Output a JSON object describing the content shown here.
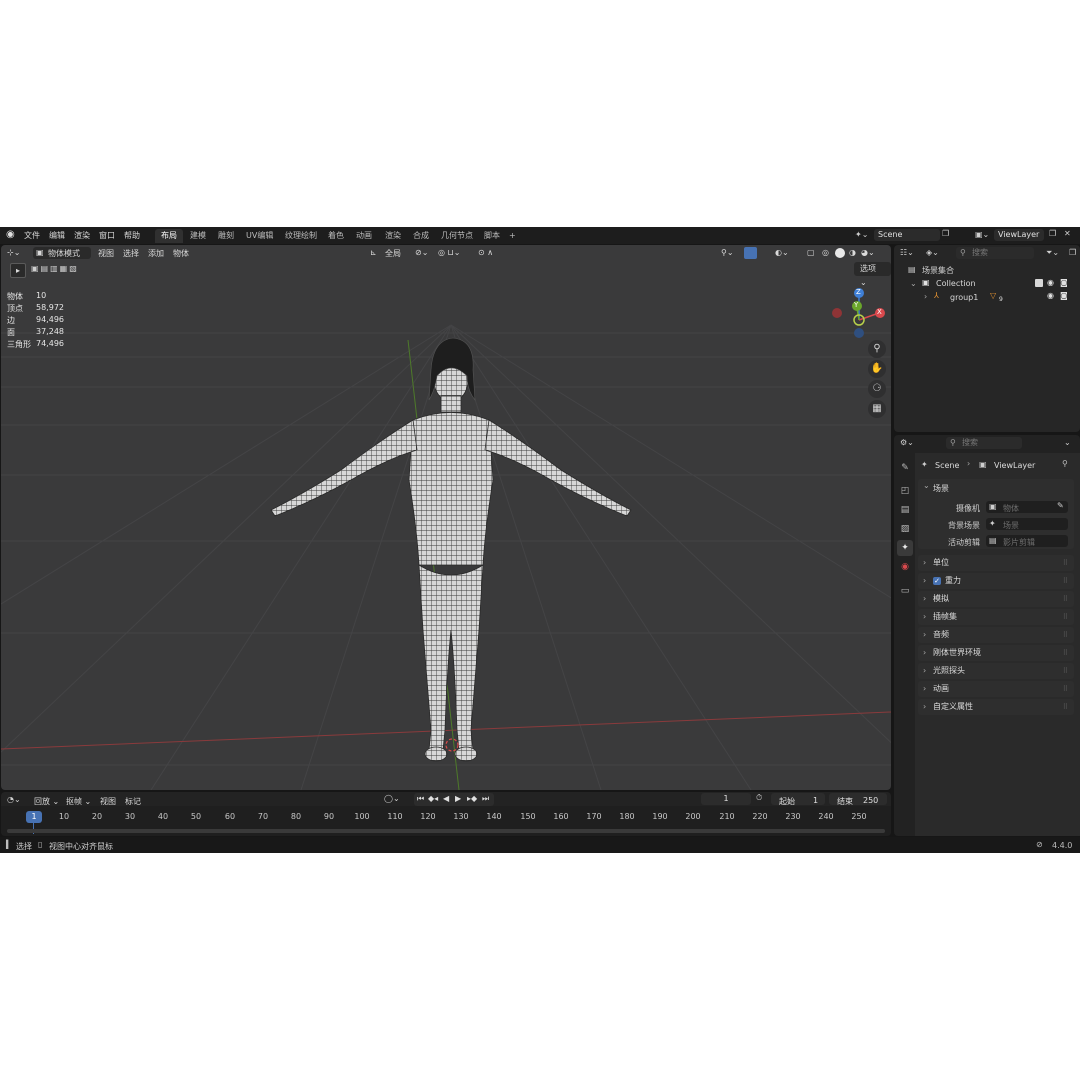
{
  "menu": {
    "items": [
      "文件",
      "编辑",
      "渲染",
      "窗口",
      "帮助"
    ]
  },
  "workspaces": {
    "tabs": [
      "布局",
      "建模",
      "雕刻",
      "UV编辑",
      "纹理绘制",
      "着色",
      "动画",
      "渲染",
      "合成",
      "几何节点",
      "脚本"
    ],
    "add": "+"
  },
  "scene": {
    "name": "Scene",
    "view_layer": "ViewLayer"
  },
  "viewport": {
    "mode": "物体模式",
    "menus": [
      "视图",
      "选择",
      "添加",
      "物体"
    ],
    "transform": "全局",
    "options": "选项",
    "stats": [
      {
        "label": "物体",
        "value": "10"
      },
      {
        "label": "顶点",
        "value": "58,972"
      },
      {
        "label": "边",
        "value": "94,496"
      },
      {
        "label": "面",
        "value": "37,248"
      },
      {
        "label": "三角形",
        "value": "74,496"
      }
    ],
    "axes": {
      "z": "Z",
      "y": "Y",
      "x": "X"
    }
  },
  "outliner": {
    "search_placeholder": "搜索",
    "root": "场景集合",
    "collection": "Collection",
    "object": "group1",
    "object_badge": "9"
  },
  "properties": {
    "search_placeholder": "搜索",
    "breadcrumb": [
      "Scene",
      "ViewLayer"
    ],
    "section_scene": "场景",
    "fields": [
      {
        "label": "摄像机",
        "placeholder": "物体"
      },
      {
        "label": "背景场景",
        "placeholder": "场景"
      },
      {
        "label": "活动剪辑",
        "placeholder": "影片剪辑"
      }
    ],
    "sections": [
      "单位",
      "重力",
      "模拟",
      "插帧集",
      "音频",
      "刚体世界环境",
      "光照探头",
      "动画",
      "自定义属性"
    ]
  },
  "timeline": {
    "menus": [
      "回放",
      "抠帧",
      "视图",
      "标记"
    ],
    "current_frame": "1",
    "start_label": "起始",
    "start": "1",
    "end_label": "结束",
    "end": "250",
    "ticks": [
      "1",
      "10",
      "20",
      "30",
      "40",
      "50",
      "60",
      "70",
      "80",
      "90",
      "100",
      "110",
      "120",
      "130",
      "140",
      "150",
      "160",
      "170",
      "180",
      "190",
      "200",
      "210",
      "220",
      "230",
      "240",
      "250"
    ]
  },
  "status": {
    "left1": "选择",
    "left2": "视图中心对齐鼠标",
    "version": "4.4.0"
  },
  "colors": {
    "accent": "#4772b3",
    "x_axis": "#d9494d",
    "y_axis": "#6aa62b",
    "z_axis": "#3f7fd6",
    "orange": "#e39232"
  }
}
